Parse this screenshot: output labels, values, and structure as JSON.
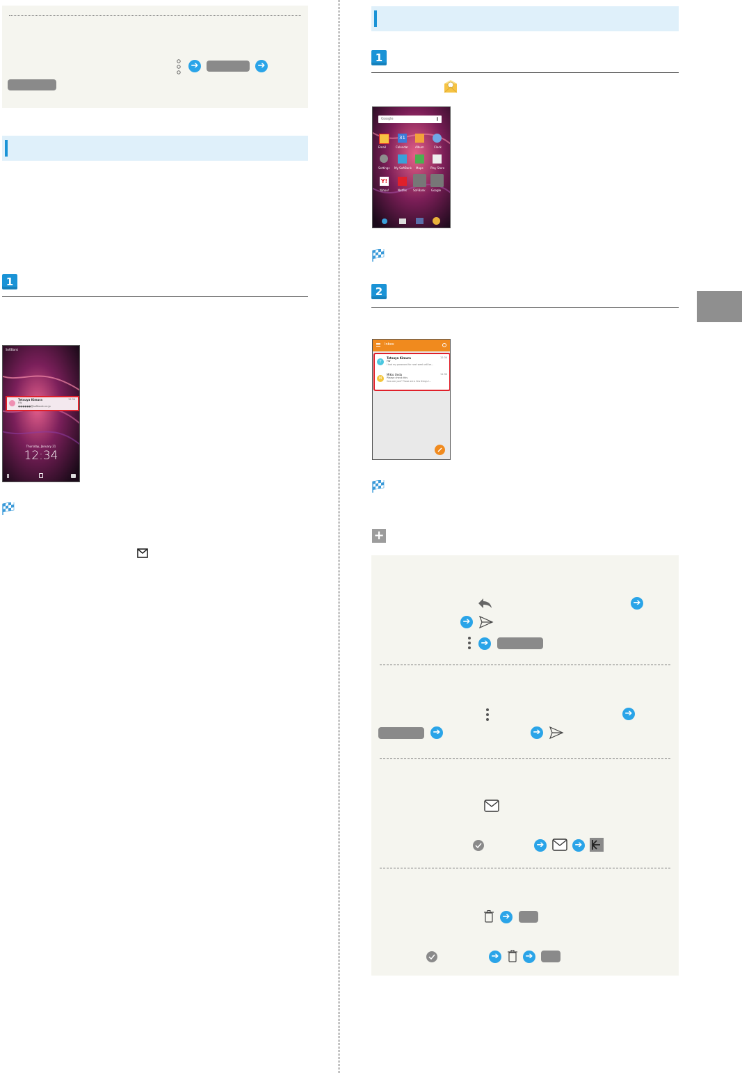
{
  "lockscreen": {
    "carrier": "SoftBank",
    "notif_sender": "Tetsuya Kimura",
    "notif_time": "12:34",
    "notif_subject": "FW",
    "notif_address": "●●●●●●@softbank.ne.jp",
    "date": "Thursday, January 21",
    "time": "12:34"
  },
  "home": {
    "search_label": "Google",
    "apps": [
      "Email",
      "Calendar",
      "Album",
      "Clock",
      "Settings",
      "My SoftBank",
      "Maps",
      "Play Store",
      "Yahoo!",
      "Netflix",
      "Sof-Bank",
      "Google"
    ],
    "calendar_day": "31"
  },
  "inbox": {
    "title": "Inbox",
    "messages": [
      {
        "sender": "Tetsuya Kimura",
        "time": "12:34",
        "subject": "FW",
        "preview": "I had my password for next week will be...",
        "avatar": "T"
      },
      {
        "sender": "Mikio Ueda",
        "time": "11:30",
        "subject": "Please check this",
        "preview": "How are you? Those are a few things I...",
        "avatar": "M"
      }
    ]
  },
  "colors": {
    "accent_blue": "#1a93d6",
    "arrow_blue": "#2aa4e8",
    "section_bg": "#dff0fa",
    "info_bg": "#f5f5ef",
    "inbox_bar": "#f08a1e",
    "highlight_red": "#e0202a"
  },
  "icons": [
    "more-vert-icon",
    "arrow-right-icon",
    "reply-icon",
    "send-icon",
    "mail-icon",
    "check-circle-icon",
    "trash-icon",
    "back-arrow-icon",
    "flag-icon",
    "plus-icon"
  ]
}
